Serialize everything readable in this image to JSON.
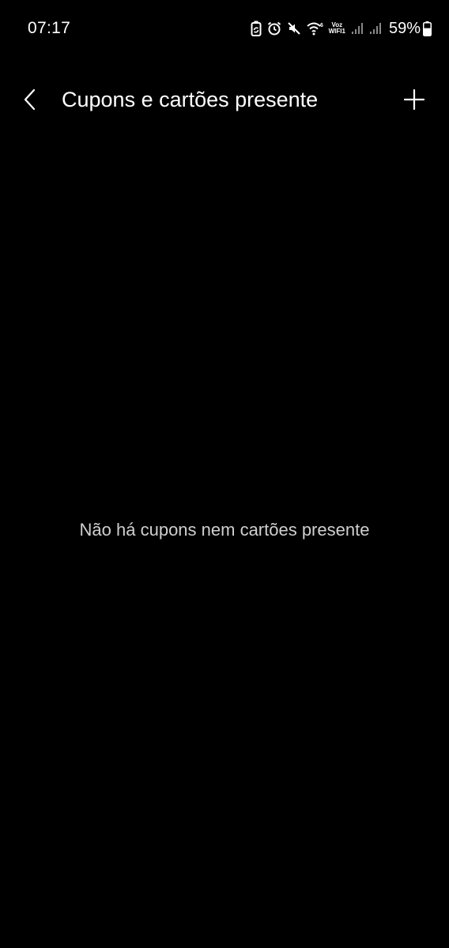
{
  "status_bar": {
    "time": "07:17",
    "voz_label_top": "Voz",
    "voz_label_bottom": "WIFI1",
    "battery_percent": "59%",
    "battery_level": 0.59,
    "icons": [
      "battery-saver-icon",
      "alarm-icon",
      "mute-icon",
      "wifi-6-icon",
      "voz-wifi-label",
      "signal-icon",
      "signal-icon",
      "battery-icon"
    ]
  },
  "app_bar": {
    "back_icon": "chevron-left-icon",
    "title": "Cupons e cartões presente",
    "add_icon": "plus-icon"
  },
  "empty_state": {
    "message": "Não há cupons nem cartões presente"
  },
  "colors": {
    "background": "#000000",
    "text_primary": "#ffffff",
    "text_secondary": "#cfcfcf"
  }
}
